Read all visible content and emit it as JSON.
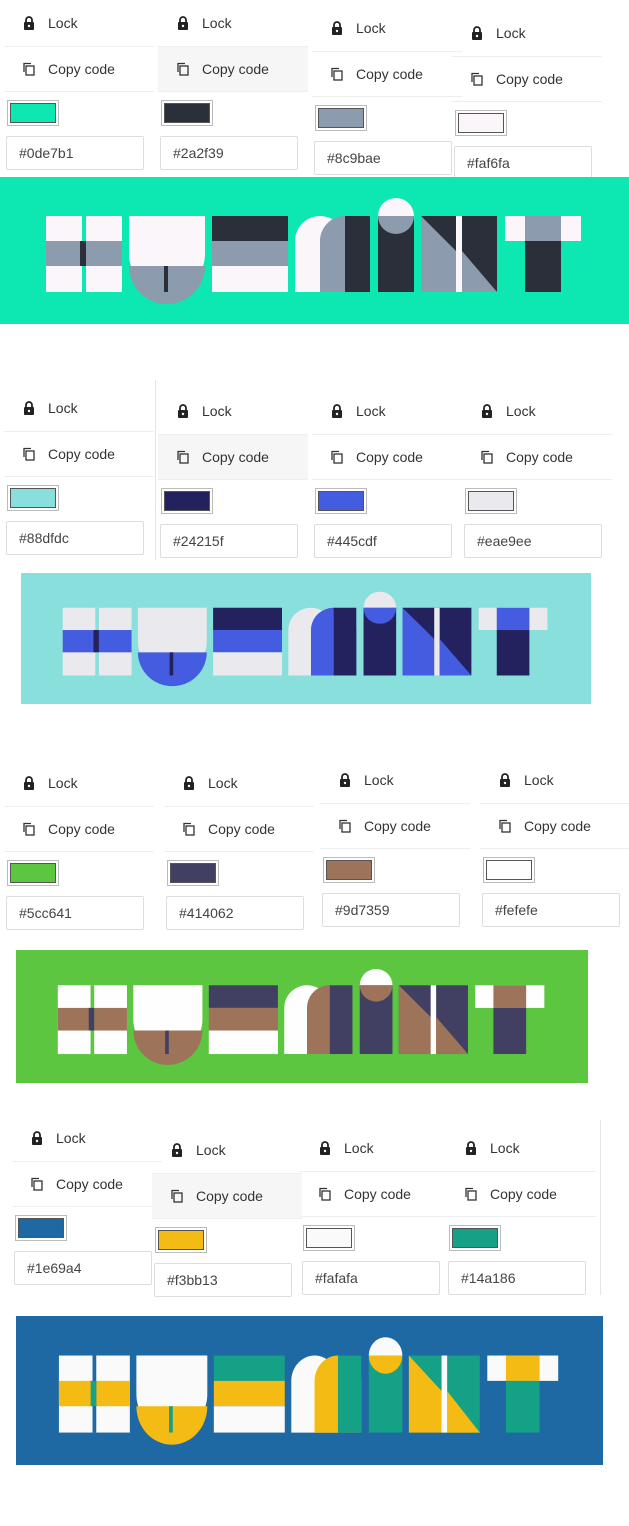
{
  "actions": {
    "lock": "Lock",
    "copy": "Copy code"
  },
  "icons": {
    "lock": "lock-icon",
    "copy": "copy-icon"
  },
  "logo_text": "HUMINT",
  "palettes": [
    {
      "swatches": [
        {
          "hex": "#0de7b1"
        },
        {
          "hex": "#2a2f39"
        },
        {
          "hex": "#8c9bae"
        },
        {
          "hex": "#faf6fa"
        }
      ],
      "banner": {
        "bg": "#0de7b1",
        "light": "#faf6fa",
        "mid": "#8c9bae",
        "dark": "#2a2f39"
      }
    },
    {
      "swatches": [
        {
          "hex": "#88dfdc"
        },
        {
          "hex": "#24215f"
        },
        {
          "hex": "#445cdf"
        },
        {
          "hex": "#eae9ee"
        }
      ],
      "banner": {
        "bg": "#88dfdc",
        "light": "#eae9ee",
        "mid": "#445cdf",
        "dark": "#24215f"
      }
    },
    {
      "swatches": [
        {
          "hex": "#5cc641"
        },
        {
          "hex": "#414062"
        },
        {
          "hex": "#9d7359"
        },
        {
          "hex": "#fefefe"
        }
      ],
      "banner": {
        "bg": "#5cc641",
        "light": "#fefefe",
        "mid": "#9d7359",
        "dark": "#414062"
      }
    },
    {
      "swatches": [
        {
          "hex": "#1e69a4"
        },
        {
          "hex": "#f3bb13"
        },
        {
          "hex": "#fafafa"
        },
        {
          "hex": "#14a186"
        }
      ],
      "banner": {
        "bg": "#1e69a4",
        "light": "#fafafa",
        "mid": "#f3bb13",
        "dark": "#14a186"
      }
    }
  ]
}
